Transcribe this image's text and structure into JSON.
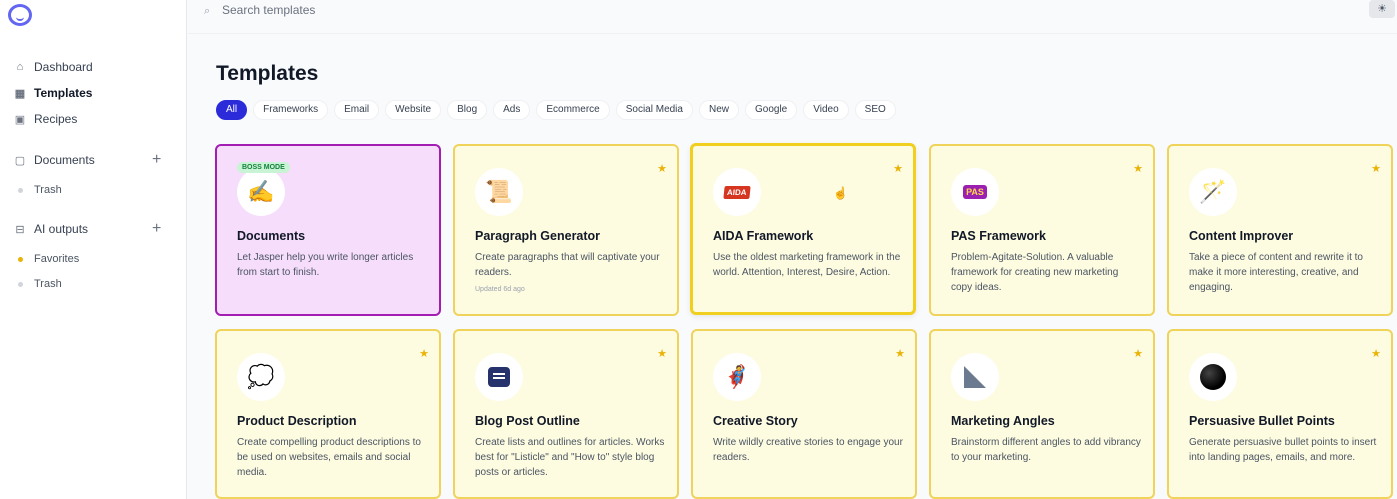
{
  "search": {
    "placeholder": "Search templates"
  },
  "sidebar": {
    "items": [
      {
        "label": "Dashboard",
        "icon": "home-icon"
      },
      {
        "label": "Templates",
        "icon": "grid-icon"
      },
      {
        "label": "Recipes",
        "icon": "terminal-icon"
      }
    ],
    "documents": {
      "label": "Documents",
      "trash": "Trash"
    },
    "ai_outputs": {
      "label": "AI outputs",
      "favorites": "Favorites",
      "trash": "Trash"
    }
  },
  "page": {
    "title": "Templates"
  },
  "filters": [
    "All",
    "Frameworks",
    "Email",
    "Website",
    "Blog",
    "Ads",
    "Ecommerce",
    "Social Media",
    "New",
    "Google",
    "Video",
    "SEO"
  ],
  "cards": [
    {
      "title": "Documents",
      "desc": "Let Jasper help you write longer articles from start to finish.",
      "badge": "BOSS MODE",
      "icon": "writing-hand-icon"
    },
    {
      "title": "Paragraph Generator",
      "desc": "Create paragraphs that will captivate your readers.",
      "meta": "Updated 6d ago",
      "icon": "scroll-icon"
    },
    {
      "title": "AIDA Framework",
      "desc": "Use the oldest marketing framework in the world. Attention, Interest, Desire, Action.",
      "icon_text": "AIDA"
    },
    {
      "title": "PAS Framework",
      "desc": "Problem-Agitate-Solution. A valuable framework for creating new marketing copy ideas.",
      "icon_text": "PAS"
    },
    {
      "title": "Content Improver",
      "desc": "Take a piece of content and rewrite it to make it more interesting, creative, and engaging.",
      "icon": "magic-wand-icon"
    },
    {
      "title": "Product Description",
      "desc": "Create compelling product descriptions to be used on websites, emails and social media.",
      "icon": "thought-bubble-icon"
    },
    {
      "title": "Blog Post Outline",
      "desc": "Create lists and outlines for articles. Works best for \"Listicle\" and \"How to\" style blog posts or articles.",
      "icon": "chat-icon"
    },
    {
      "title": "Creative Story",
      "desc": "Write wildly creative stories to engage your readers.",
      "icon": "superhero-icon"
    },
    {
      "title": "Marketing Angles",
      "desc": "Brainstorm different angles to add vibrancy to your marketing.",
      "icon": "triangle-ruler-icon"
    },
    {
      "title": "Persuasive Bullet Points",
      "desc": "Generate persuasive bullet points to insert into landing pages, emails, and more.",
      "icon": "black-circle-icon"
    }
  ],
  "colors": {
    "accent": "#2b2bd9",
    "card_bg": "#fdfbe0",
    "card_border": "#f0d35a",
    "boss_bg": "#f6ddfb",
    "boss_border": "#a31db3"
  }
}
